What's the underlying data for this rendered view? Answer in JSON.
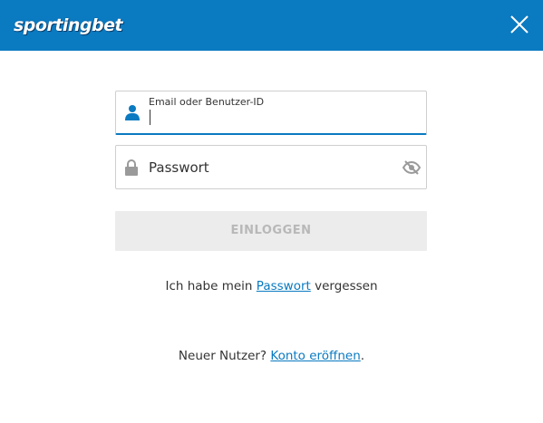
{
  "header": {
    "logo_text": "sportingbet",
    "close_icon": "close-icon",
    "background_color": "#0a7ac1"
  },
  "login_form": {
    "email": {
      "label": "Email oder Benutzer-ID",
      "value": "",
      "icon": "user-icon"
    },
    "password": {
      "placeholder": "Passwort",
      "value": "",
      "icon": "lock-icon",
      "toggle_icon": "eye-slash-icon"
    },
    "submit_label": "EINLOGGEN"
  },
  "forgot": {
    "prefix": "Ich habe mein ",
    "link": "Passwort",
    "suffix": " vergessen"
  },
  "register": {
    "prefix": "Neuer Nutzer? ",
    "link": "Konto eröffnen",
    "suffix": "."
  },
  "colors": {
    "accent": "#0a7ac1",
    "disabled_button_bg": "#ececec",
    "disabled_button_text": "#b8b8b8"
  }
}
